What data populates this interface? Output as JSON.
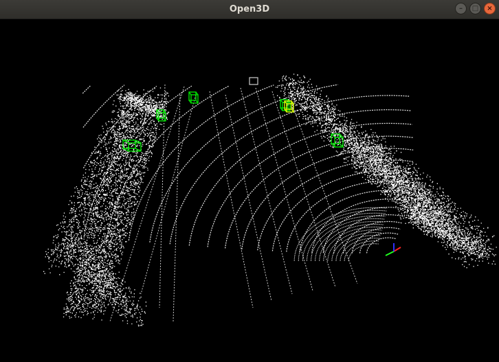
{
  "window": {
    "title": "Open3D",
    "controls": {
      "minimize_glyph": "–",
      "maximize_glyph": "□",
      "close_glyph": "×"
    }
  },
  "viewport": {
    "background": "#000000",
    "point_color": "#ffffff",
    "box_color": "#00e000",
    "highlight_box_color": "#d8ff00",
    "axis_colors": {
      "x": "#ff2020",
      "y": "#20ff20",
      "z": "#3030ff"
    }
  }
}
